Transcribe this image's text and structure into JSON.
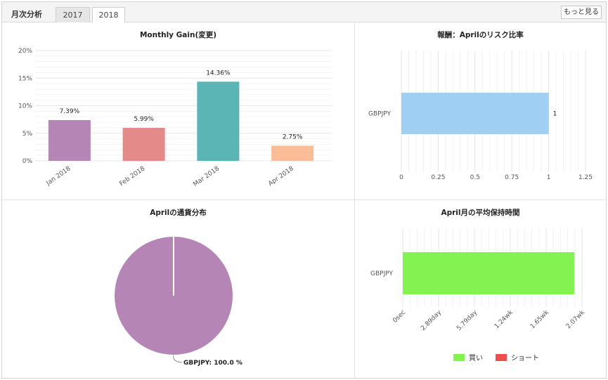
{
  "header": {
    "title": "月次分析",
    "tabs": [
      {
        "label": "2017",
        "active": false
      },
      {
        "label": "2018",
        "active": true
      }
    ],
    "more_label": "もっと見る"
  },
  "chart_data": [
    {
      "type": "bar",
      "title": "Monthly Gain(変更)",
      "categories": [
        "Jan 2018",
        "Feb 2018",
        "Mar 2018",
        "Apr 2018"
      ],
      "values": [
        7.39,
        5.99,
        14.36,
        2.75
      ],
      "value_labels": [
        "7.39%",
        "5.99%",
        "14.36%",
        "2.75%"
      ],
      "colors": [
        "#b485b5",
        "#e48a88",
        "#5bb5b5",
        "#fbbd98"
      ],
      "yticks": [
        "0%",
        "5%",
        "10%",
        "15%",
        "20%"
      ],
      "ylim": [
        0,
        20
      ]
    },
    {
      "type": "bar",
      "orientation": "horizontal",
      "title": "報酬：Aprilのリスク比率",
      "categories": [
        "GBPJPY"
      ],
      "values": [
        1
      ],
      "value_labels": [
        "1"
      ],
      "color": "#9fcff3",
      "xticks": [
        "0",
        "0.25",
        "0.5",
        "0.75",
        "1",
        "1.25"
      ],
      "xlim": [
        0,
        1.25
      ]
    },
    {
      "type": "pie",
      "title": "Aprilの通貨分布",
      "slices": [
        {
          "name": "GBPJPY",
          "value": 100.0,
          "color": "#b485b5"
        }
      ],
      "label": "GBPJPY: 100.0 %"
    },
    {
      "type": "bar",
      "orientation": "horizontal",
      "title": "April月の平均保持時間",
      "categories": [
        "GBPJPY"
      ],
      "values": [
        1.98
      ],
      "color": "#84f250",
      "xticks": [
        "0sec",
        "2.89day",
        "5.79day",
        "1.24wk",
        "1.65wk",
        "2.07wk"
      ],
      "xlim": [
        0,
        2.07
      ],
      "legend": [
        {
          "label": "買い",
          "color": "#84f250"
        },
        {
          "label": "ショート",
          "color": "#ee4e4e"
        }
      ]
    }
  ]
}
